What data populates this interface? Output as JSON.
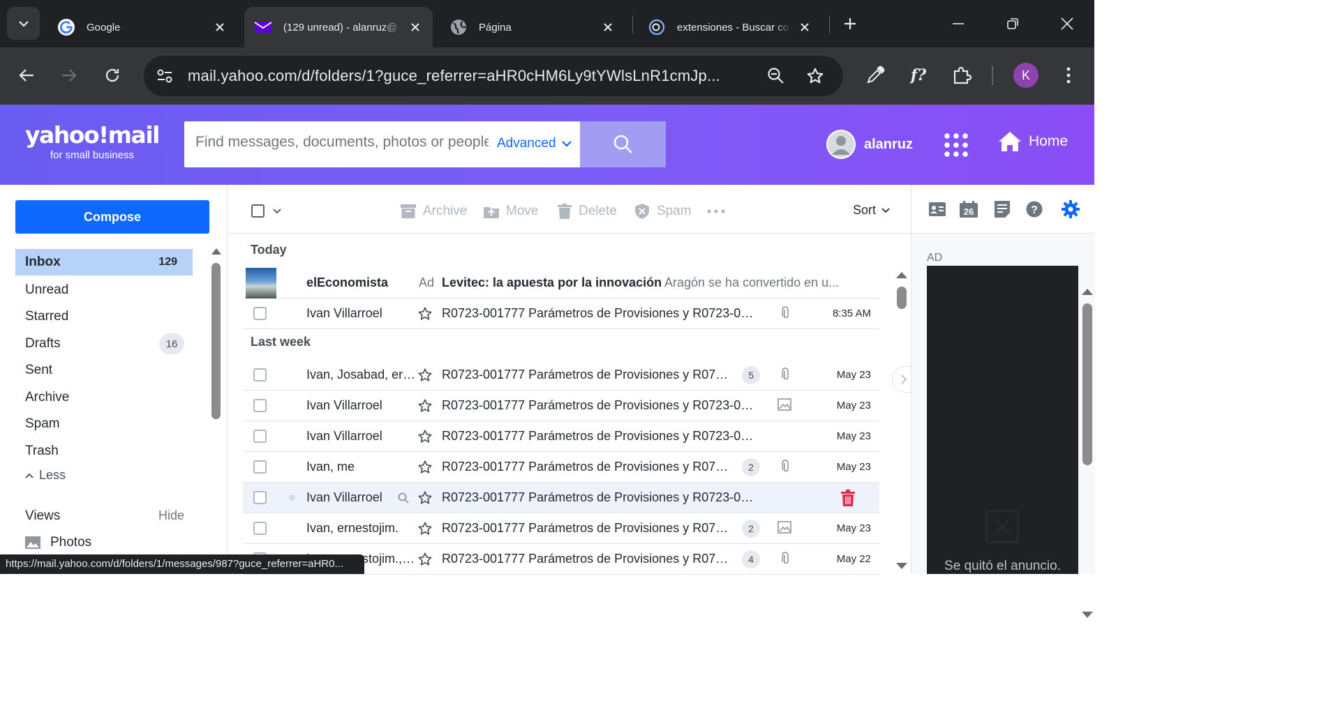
{
  "browser": {
    "tabs": [
      {
        "title": "Google",
        "favicon": "google-icon"
      },
      {
        "title": "(129 unread) - alanruz@",
        "favicon": "yahoo-mail-icon"
      },
      {
        "title": "Página",
        "favicon": "globe-icon"
      },
      {
        "title": "extensiones - Buscar co",
        "favicon": "search-extension-icon"
      }
    ],
    "url": "mail.yahoo.com/d/folders/1?guce_referrer=aHR0cHM6Ly9tYWlsLnR1cmJp...",
    "profile_initial": "K",
    "status_url": "https://mail.yahoo.com/d/folders/1/messages/987?guce_referrer=aHR0..."
  },
  "header": {
    "logo_text": "yahoo!mail",
    "logo_sub": "for small business",
    "search_placeholder": "Find messages, documents, photos or people",
    "advanced_label": "Advanced",
    "username": "alanruz",
    "home_label": "Home",
    "accent": "#6a5cf0"
  },
  "sidebar": {
    "compose_label": "Compose",
    "folders": [
      {
        "label": "Inbox",
        "count": "129"
      },
      {
        "label": "Unread",
        "count": ""
      },
      {
        "label": "Starred",
        "count": ""
      },
      {
        "label": "Drafts",
        "count": "16"
      },
      {
        "label": "Sent",
        "count": ""
      },
      {
        "label": "Archive",
        "count": ""
      },
      {
        "label": "Spam",
        "count": ""
      },
      {
        "label": "Trash",
        "count": ""
      }
    ],
    "less_label": "Less",
    "views_label": "Views",
    "hide_label": "Hide",
    "photos_label": "Photos"
  },
  "toolbar": {
    "archive": "Archive",
    "move": "Move",
    "delete": "Delete",
    "spam": "Spam",
    "sort": "Sort"
  },
  "messages": {
    "today_label": "Today",
    "last_week_label": "Last week",
    "ad": {
      "sender": "elEconomista",
      "label": "Ad",
      "subject": "Levitec: la apuesta por la innovación",
      "preview": "Aragón se ha convertido en u..."
    },
    "today": [
      {
        "sender": "Ivan Villarroel",
        "subject": "R0723-001777 Parámetros de Provisiones y R0723-0017...",
        "count": "",
        "indicator": "paperclip-icon",
        "date": "8:35 AM"
      }
    ],
    "last_week": [
      {
        "sender": "Ivan, Josabad, ern...",
        "subject": "R0723-001777 Parámetros de Provisiones y R0723-...",
        "count": "5",
        "indicator": "paperclip-icon",
        "date": "May 23"
      },
      {
        "sender": "Ivan Villarroel",
        "subject": "R0723-001777 Parámetros de Provisiones y R0723-0017...",
        "count": "",
        "indicator": "image-icon",
        "date": "May 23"
      },
      {
        "sender": "Ivan Villarroel",
        "subject": "R0723-001777 Parámetros de Provisiones y R0723-0017...",
        "count": "",
        "indicator": "",
        "date": "May 23"
      },
      {
        "sender": "Ivan, me",
        "subject": "R0723-001777 Parámetros de Provisiones y R0723-...",
        "count": "2",
        "indicator": "paperclip-icon",
        "date": "May 23"
      },
      {
        "sender": "Ivan Villarroel",
        "subject": "R0723-001777 Parámetros de Provisiones y R0723-0017...",
        "count": "",
        "indicator": "",
        "date": ""
      },
      {
        "sender": "Ivan, ernestojim.",
        "subject": "R0723-001777 Parámetros de Provisiones y R0723-...",
        "count": "2",
        "indicator": "image-icon",
        "date": "May 23"
      },
      {
        "sender": "Ivan, ernestojim., J...",
        "subject": "R0723-001777 Parámetros de Provisiones y R0723-...",
        "count": "4",
        "indicator": "paperclip-icon",
        "date": "May 22"
      }
    ]
  },
  "right_rail": {
    "calendar_day": "26",
    "ad_label": "AD",
    "ad_removed_text": "Se quitó el anuncio."
  }
}
